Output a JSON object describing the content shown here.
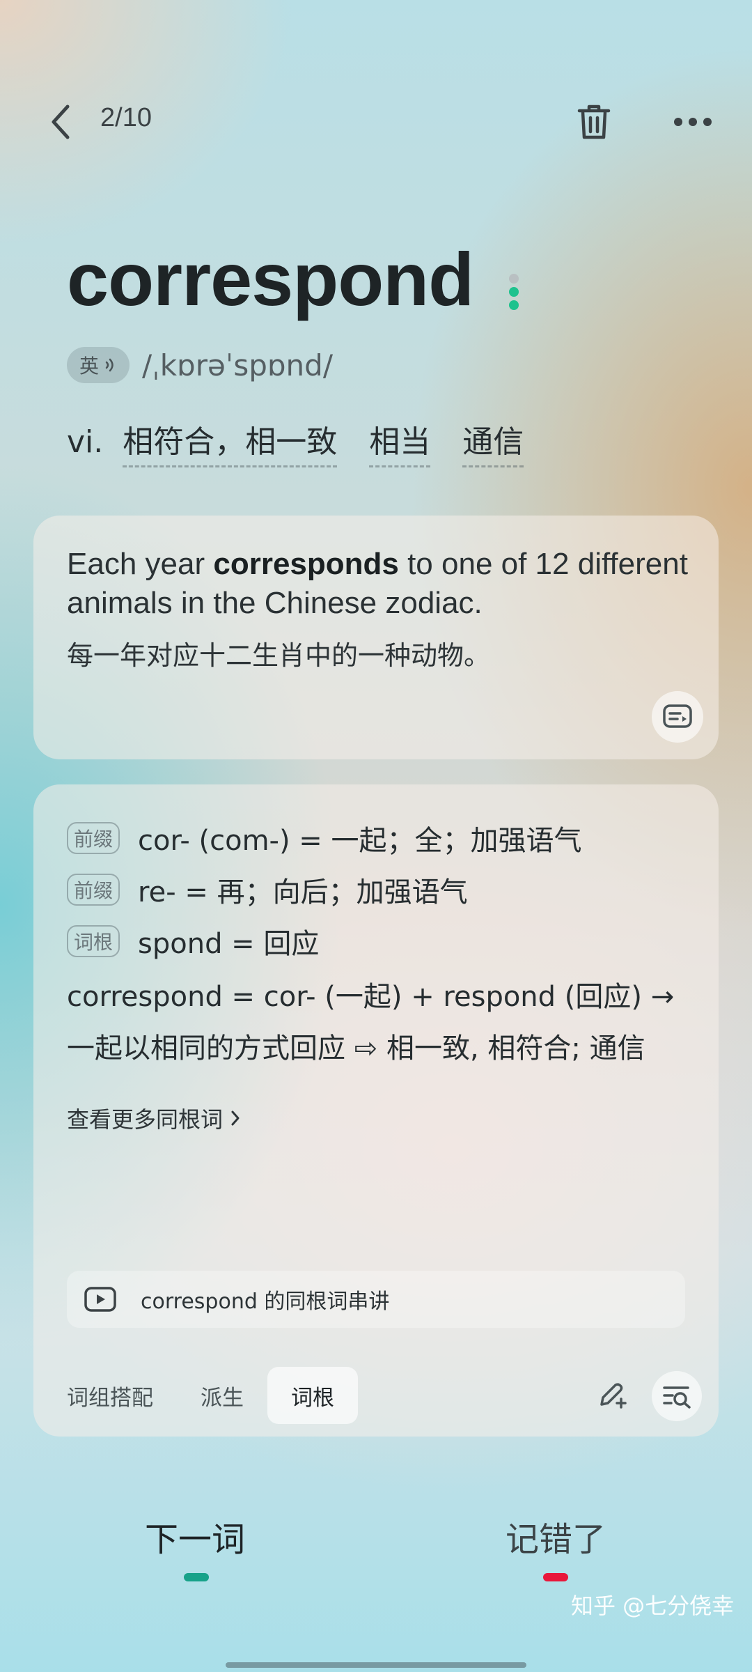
{
  "header": {
    "counter": "2/10"
  },
  "word": {
    "text": "correspond",
    "lang_badge": "英",
    "phonetic": "/ˌkɒrəˈspɒnd/",
    "pos": "vi.",
    "meanings": [
      "相符合，相一致",
      "相当",
      "通信"
    ]
  },
  "example": {
    "en_before": "Each year ",
    "en_bold": "corresponds",
    "en_after": " to one of 12 different animals in the Chinese zodiac.",
    "zh": "每一年对应十二生肖中的一种动物。"
  },
  "roots": {
    "items": [
      {
        "tag": "前缀",
        "text": "cor- (com-) = 一起；全；加强语气"
      },
      {
        "tag": "前缀",
        "text": "re- = 再；向后；加强语气"
      },
      {
        "tag": "词根",
        "text": "spond = 回应"
      }
    ],
    "formula_part1": "correspond = cor- (一起) + respond (回应) → 一起以相同的方式回应",
    "formula_arrow": "⇨",
    "formula_part2": "相一致, 相符合; 通信",
    "more_link": "查看更多同根词",
    "video_label": "correspond 的同根词串讲"
  },
  "tabs": [
    {
      "label": "词组搭配",
      "active": false
    },
    {
      "label": "派生",
      "active": false
    },
    {
      "label": "词根",
      "active": true
    }
  ],
  "bottom": {
    "next_label": "下一词",
    "wrong_label": "记错了"
  },
  "watermark": "知乎 @七分侥幸",
  "colors": {
    "accent_green": "#17a289",
    "accent_red": "#e8173a"
  }
}
